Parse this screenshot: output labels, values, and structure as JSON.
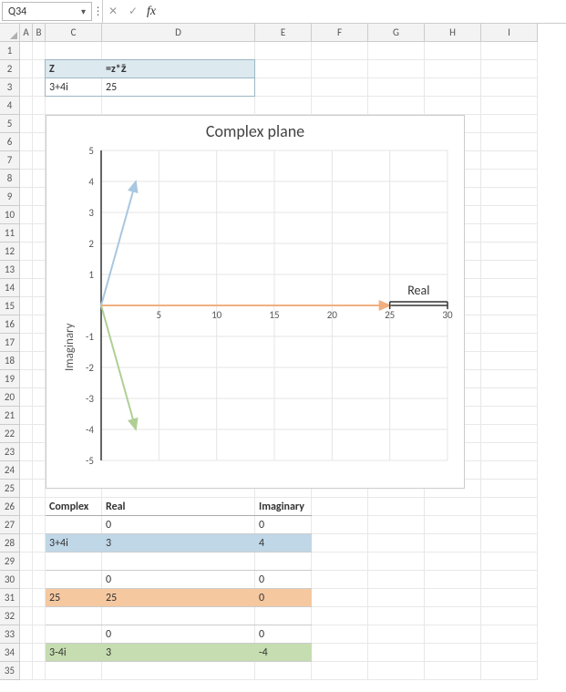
{
  "formula_bar": {
    "name_box": "Q34",
    "formula": ""
  },
  "columns": [
    {
      "label": "A",
      "w": 14
    },
    {
      "label": "B",
      "w": 14
    },
    {
      "label": "C",
      "w": 62
    },
    {
      "label": "D",
      "w": 168
    },
    {
      "label": "E",
      "w": 62
    },
    {
      "label": "F",
      "w": 62
    },
    {
      "label": "G",
      "w": 62
    },
    {
      "label": "H",
      "w": 62
    },
    {
      "label": "I",
      "w": 62
    }
  ],
  "row_count": 35,
  "header_block": {
    "c2": "Z",
    "d2": "=z*z̄",
    "c3": "3+4i",
    "d3": "25"
  },
  "chart": {
    "title": "Complex plane",
    "xlabel": "Real",
    "ylabel": "Imaginary"
  },
  "chart_data": {
    "type": "line",
    "title": "Complex plane",
    "xlabel": "Real",
    "ylabel": "Imaginary",
    "xlim": [
      0,
      30
    ],
    "ylim": [
      -5,
      5
    ],
    "xticks": [
      5,
      10,
      15,
      20,
      25,
      30
    ],
    "yticks": [
      -5,
      -4,
      -3,
      -2,
      -1,
      1,
      2,
      3,
      4,
      5
    ],
    "series": [
      {
        "name": "3+4i",
        "color": "#a8c7e0",
        "points": [
          [
            0,
            0
          ],
          [
            3,
            4
          ]
        ]
      },
      {
        "name": "25",
        "color": "#f0b080",
        "points": [
          [
            0,
            0
          ],
          [
            25,
            0
          ]
        ]
      },
      {
        "name": "3-4i",
        "color": "#b0cf95",
        "points": [
          [
            0,
            0
          ],
          [
            3,
            -4
          ]
        ]
      }
    ]
  },
  "table": {
    "headers": {
      "complex": "Complex",
      "real": "Real",
      "imag": "Imaginary"
    },
    "rows": [
      {
        "c": "",
        "r": "0",
        "i": "0",
        "cls": ""
      },
      {
        "c": "3+4i",
        "r": "3",
        "i": "4",
        "cls": "row-blue"
      },
      {
        "c": "",
        "r": "",
        "i": "",
        "cls": ""
      },
      {
        "c": "",
        "r": "0",
        "i": "0",
        "cls": ""
      },
      {
        "c": "25",
        "r": "25",
        "i": "0",
        "cls": "row-orange"
      },
      {
        "c": "",
        "r": "",
        "i": "",
        "cls": ""
      },
      {
        "c": "",
        "r": "0",
        "i": "0",
        "cls": ""
      },
      {
        "c": "3-4i",
        "r": "3",
        "i": "-4",
        "cls": "row-green"
      }
    ]
  }
}
